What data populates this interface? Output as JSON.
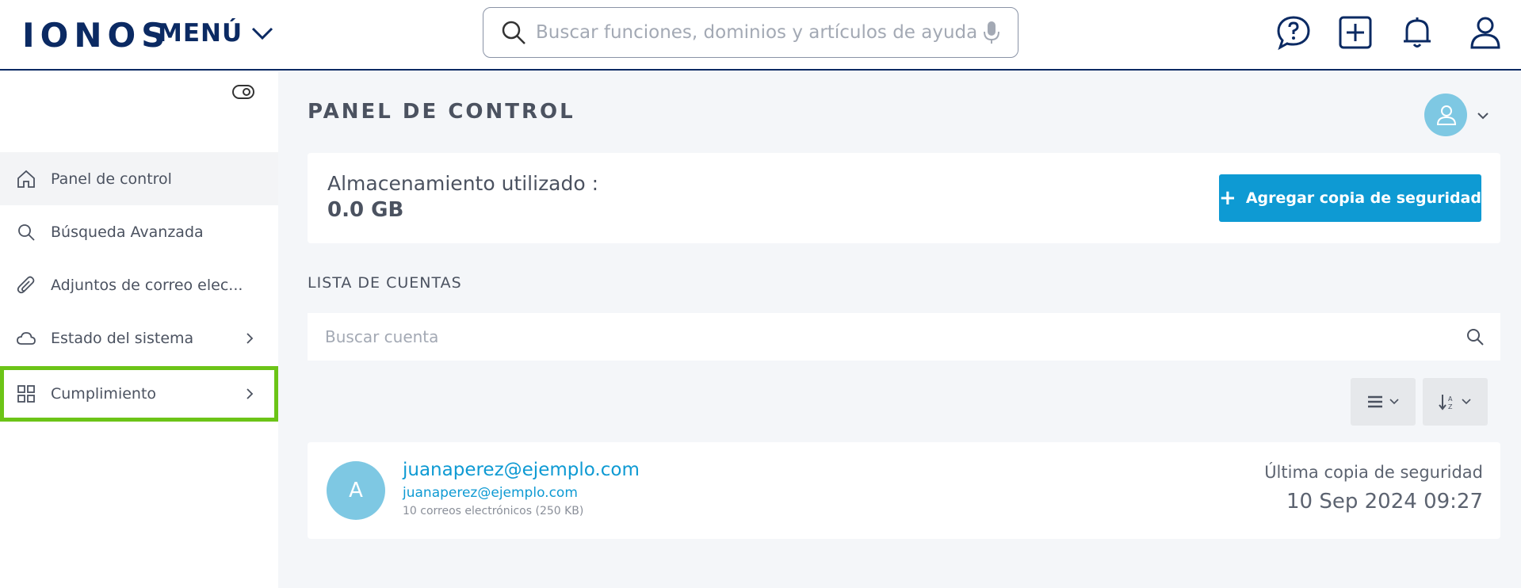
{
  "header": {
    "logo": "IONOS",
    "menu_label": "MENÚ",
    "search_placeholder": "Buscar funciones, dominios y artículos de ayuda"
  },
  "icons": {
    "help": "help-chat-icon",
    "add": "plus-square-icon",
    "notifications": "bell-icon",
    "profile": "user-icon"
  },
  "sidebar": {
    "items": [
      {
        "label": "Panel de control",
        "icon": "home-icon",
        "active": true
      },
      {
        "label": "Búsqueda Avanzada",
        "icon": "search-icon"
      },
      {
        "label": "Adjuntos de correo elec...",
        "icon": "paperclip-icon"
      },
      {
        "label": "Estado del sistema",
        "icon": "cloud-icon"
      },
      {
        "label": "Cumplimiento",
        "icon": "grid-icon",
        "highlighted": true
      }
    ]
  },
  "main": {
    "title": "PANEL DE CONTROL",
    "storage_label": "Almacenamiento utilizado :",
    "storage_value": "0.0 GB",
    "backup_button": "Agregar copia de seguridad",
    "accounts_section_label": "LISTA DE CUENTAS",
    "account_search_placeholder": "Buscar cuenta",
    "accounts": [
      {
        "avatar_letter": "A",
        "email": "juanaperez@ejemplo.com",
        "email_secondary": "juanaperez@ejemplo.com",
        "meta": "10 correos electrónicos (250 KB)",
        "last_backup_label": "Última copia de seguridad",
        "last_backup_date": "10 Sep 2024 09:27"
      }
    ]
  },
  "colors": {
    "brand": "#0b2a63",
    "accent": "#0e9ad3",
    "avatar": "#7ec8e3",
    "highlight": "#6cc417"
  }
}
